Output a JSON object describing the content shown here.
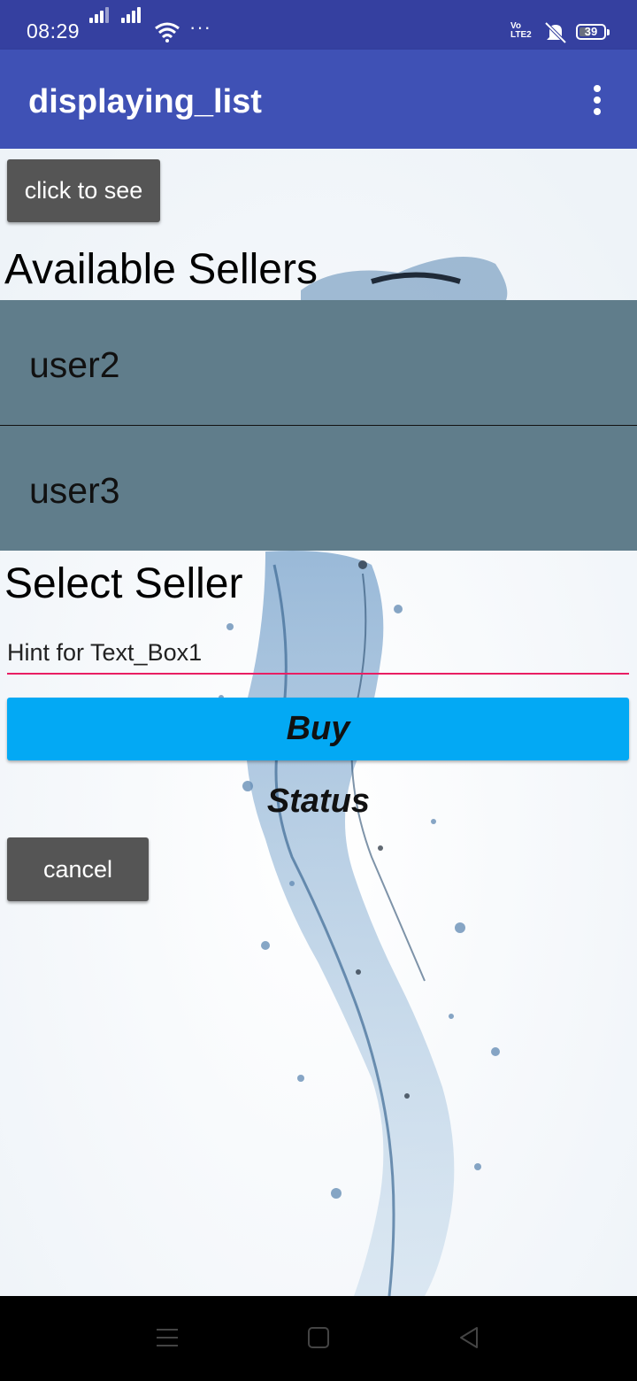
{
  "status_bar": {
    "time": "08:29",
    "more_indicator": "···",
    "network_label_top": "Vo",
    "network_label_bottom": "LTE2",
    "battery_level": "39",
    "icons": [
      "signal-icon",
      "signal-icon",
      "wifi-icon",
      "volte-icon",
      "mute-icon",
      "battery-icon"
    ]
  },
  "app_bar": {
    "title": "displaying_list",
    "menu_icon": "more-vert-icon"
  },
  "main": {
    "click_button_label": "click to see",
    "available_heading": "Available Sellers",
    "sellers": [
      {
        "label": "user2"
      },
      {
        "label": "user3"
      }
    ],
    "select_heading": "Select Seller",
    "text_box_hint": "Hint for Text_Box1",
    "buy_button_label": "Buy",
    "status_label": "Status",
    "cancel_button_label": "cancel"
  },
  "nav_bar": {
    "icons": [
      "menu-icon",
      "home-icon",
      "back-icon"
    ]
  },
  "colors": {
    "status_bar": "#3540a0",
    "app_bar": "#3f51b5",
    "list_item": "#607d8b",
    "gray_button": "#555555",
    "buy_button": "#03a9f4",
    "input_underline": "#e91e63"
  }
}
